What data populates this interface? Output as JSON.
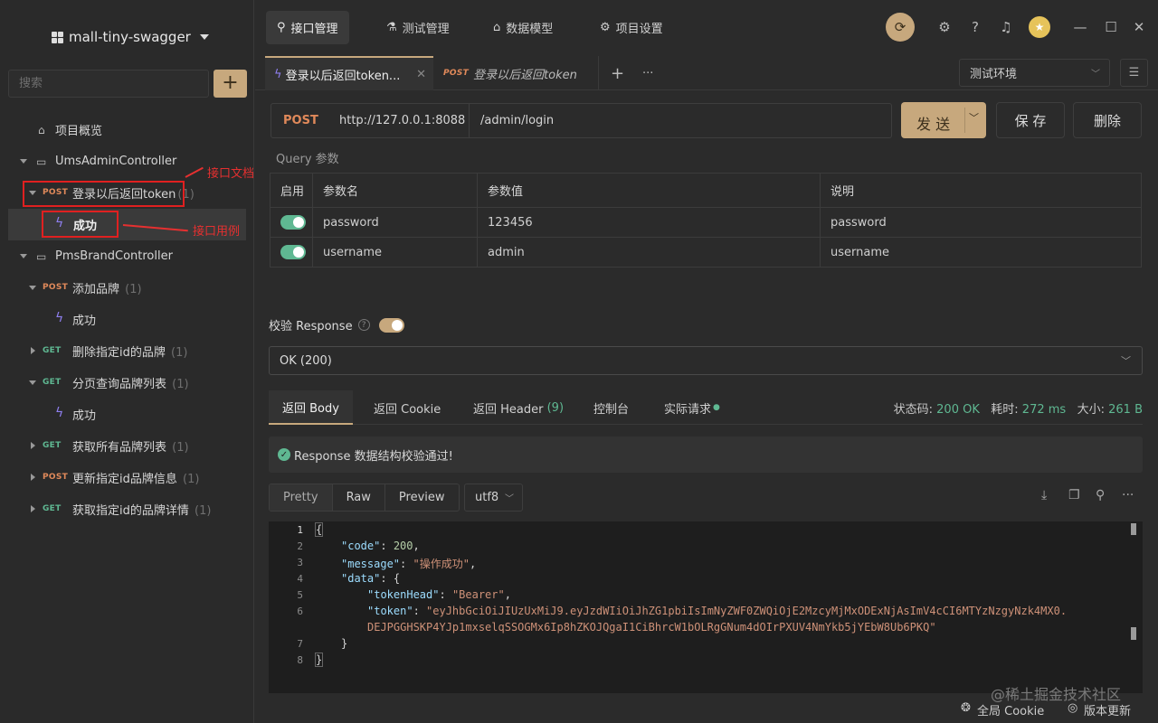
{
  "project": {
    "name": "mall-tiny-swagger"
  },
  "search": {
    "placeholder": "搜索"
  },
  "tree": {
    "overview": "项目概览",
    "controller1": "UmsAdminController",
    "item_login": {
      "method": "POST",
      "label": "登录以后返回token",
      "count": "(1)"
    },
    "case_login": "成功",
    "controller2": "PmsBrandController",
    "items": [
      {
        "method": "POST",
        "label": "添加品牌",
        "count": "(1)"
      },
      {
        "case": "成功"
      },
      {
        "method": "GET",
        "label": "删除指定id的品牌",
        "count": "(1)"
      },
      {
        "method": "GET",
        "label": "分页查询品牌列表",
        "count": "(1)"
      },
      {
        "case": "成功"
      },
      {
        "method": "GET",
        "label": "获取所有品牌列表",
        "count": "(1)"
      },
      {
        "method": "POST",
        "label": "更新指定id品牌信息",
        "count": "(1)"
      },
      {
        "method": "GET",
        "label": "获取指定id的品牌详情",
        "count": "(1)"
      }
    ]
  },
  "annotations": {
    "doc": "接口文档",
    "case": "接口用例"
  },
  "top_tabs": [
    "接口管理",
    "测试管理",
    "数据模型",
    "项目设置"
  ],
  "req_tabs": {
    "tab1": "登录以后返回token...",
    "tab2_method": "POST",
    "tab2": "登录以后返回token",
    "plus": "+",
    "more": "···"
  },
  "env": "测试环境",
  "request": {
    "method": "POST",
    "base": "http://127.0.0.1:8088",
    "path": "/admin/login"
  },
  "buttons": {
    "send": "发 送",
    "save": "保 存",
    "delete": "删除"
  },
  "query": {
    "title": "Query 参数",
    "headers": [
      "启用",
      "参数名",
      "参数值",
      "说明"
    ],
    "rows": [
      {
        "name": "password",
        "value": "123456",
        "desc": "password"
      },
      {
        "name": "username",
        "value": "admin",
        "desc": "username"
      }
    ]
  },
  "validate": {
    "label": "校验 Response",
    "qmark": "?",
    "select": "OK (200)"
  },
  "resp_tabs": {
    "body": "返回 Body",
    "cookie": "返回 Cookie",
    "header": "返回 Header",
    "header_count": "(9)",
    "console": "控制台",
    "actual": "实际请求"
  },
  "stats": {
    "status_label": "状态码:",
    "status": "200 OK",
    "time_label": "耗时:",
    "time": "272 ms",
    "size_label": "大小:",
    "size": "261 B"
  },
  "validation_msg": "Response 数据结构校验通过!",
  "view_modes": [
    "Pretty",
    "Raw",
    "Preview"
  ],
  "encoding": "utf8",
  "code": {
    "lines": [
      "1",
      "2",
      "3",
      "4",
      "5",
      "6",
      "",
      "7",
      "8"
    ],
    "l1": "{",
    "l2k": "\"code\"",
    "l2v": "200",
    "l3k": "\"message\"",
    "l3v": "\"操作成功\"",
    "l4k": "\"data\"",
    "l4v": "{",
    "l5k": "\"tokenHead\"",
    "l5v": "\"Bearer\"",
    "l6k": "\"token\"",
    "l6v": "\"eyJhbGciOiJIUzUxMiJ9.eyJzdWIiOiJhZG1pbiIsImNyZWF0ZWQiOjE2MzcyMjMxODExNjAsImV4cCI6MTYzNzgyNzk4MX0.",
    "l6v2": "DEJPGGHSKP4YJp1mxselqSSOGMx6Ip8hZKOJQgaI1CiBhrcW1bOLRgGNum4dOIrPXUV4NmYkb5jYEbW8Ub6PKQ\"",
    "l7": "}",
    "l8": "}"
  },
  "footer": {
    "cookie": "全局 Cookie",
    "update": "版本更新"
  },
  "watermark": "@稀土掘金技术社区"
}
